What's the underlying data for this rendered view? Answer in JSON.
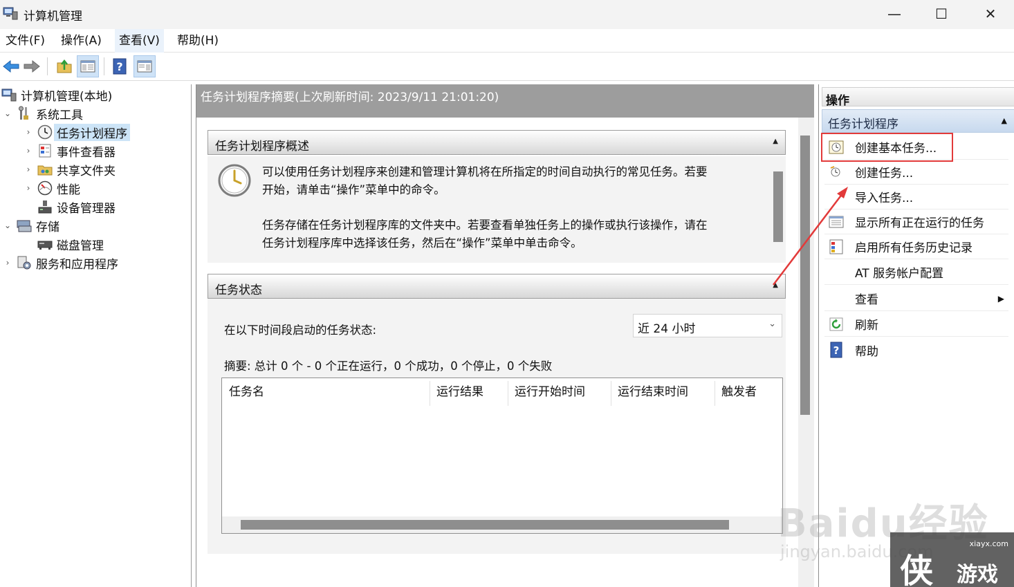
{
  "window": {
    "title": "计算机管理",
    "controls": {
      "minimize": "—",
      "maximize": "☐",
      "close": "✕"
    }
  },
  "menu": [
    {
      "label": "文件(F)"
    },
    {
      "label": "操作(A)"
    },
    {
      "label": "查看(V)"
    },
    {
      "label": "帮助(H)"
    }
  ],
  "toolbar": {
    "back": "back-arrow-icon",
    "forward": "forward-arrow-icon",
    "up_folder": "folder-up-icon",
    "show_hide_tree": "console-tree-icon",
    "help": "help-icon",
    "show_hide_actions": "action-pane-icon"
  },
  "tree": [
    {
      "label": "计算机管理(本地)",
      "icon": "computer-management-icon"
    },
    {
      "label": "系统工具",
      "icon": "tools-icon",
      "expanded": true
    },
    {
      "label": "任务计划程序",
      "icon": "clock-icon",
      "selected": true
    },
    {
      "label": "事件查看器",
      "icon": "event-viewer-icon"
    },
    {
      "label": "共享文件夹",
      "icon": "shared-folder-icon"
    },
    {
      "label": "性能",
      "icon": "performance-icon"
    },
    {
      "label": "设备管理器",
      "icon": "device-manager-icon"
    },
    {
      "label": "存储",
      "icon": "storage-icon",
      "expanded": true
    },
    {
      "label": "磁盘管理",
      "icon": "disk-icon"
    },
    {
      "label": "服务和应用程序",
      "icon": "services-icon"
    }
  ],
  "center": {
    "header": "任务计划程序摘要(上次刷新时间: 2023/9/11 21:01:20)",
    "overview": {
      "title": "任务计划程序概述",
      "para1_line1": "可以使用任务计划程序来创建和管理计算机将在所指定的时间自动执行的常见任务。若要",
      "para1_line2": "开始，请单击“操作”菜单中的命令。",
      "para2_line1": "任务存储在任务计划程序库的文件夹中。若要查看单独任务上的操作或执行该操作，请在",
      "para2_line2": "任务计划程序库中选择该任务，然后在“操作”菜单中单击命令。"
    },
    "status": {
      "title": "任务状态",
      "period_label": "在以下时间段启动的任务状态:",
      "period_value": "近 24 小时",
      "summary": "摘要: 总计 0 个 - 0 个正在运行，0 个成功，0 个停止，0 个失败",
      "columns": [
        "任务名",
        "运行结果",
        "运行开始时间",
        "运行结束时间",
        "触发者"
      ]
    }
  },
  "actions": {
    "header": "操作",
    "section": "任务计划程序",
    "items": [
      {
        "label": "创建基本任务...",
        "icon": "create-basic-task-icon"
      },
      {
        "label": "创建任务...",
        "icon": "create-task-icon"
      },
      {
        "label": "导入任务...",
        "icon": ""
      },
      {
        "label": "显示所有正在运行的任务",
        "icon": "running-tasks-icon"
      },
      {
        "label": "启用所有任务历史记录",
        "icon": "task-history-icon"
      },
      {
        "label": "AT 服务帐户配置",
        "icon": ""
      },
      {
        "label": "查看",
        "icon": "",
        "submenu": true
      },
      {
        "label": "刷新",
        "icon": "refresh-icon"
      },
      {
        "label": "帮助",
        "icon": "help-icon"
      }
    ]
  },
  "watermark": {
    "baidu": "Baidu经验",
    "jingyan": "jingyan.baidu.com",
    "site_url": "xiayx.com",
    "site_glyph": "侠",
    "site_name": "游戏"
  },
  "colors": {
    "accent_red": "#e23a3a",
    "selection": "#cce4f7",
    "header_gray": "#9d9d9d"
  }
}
